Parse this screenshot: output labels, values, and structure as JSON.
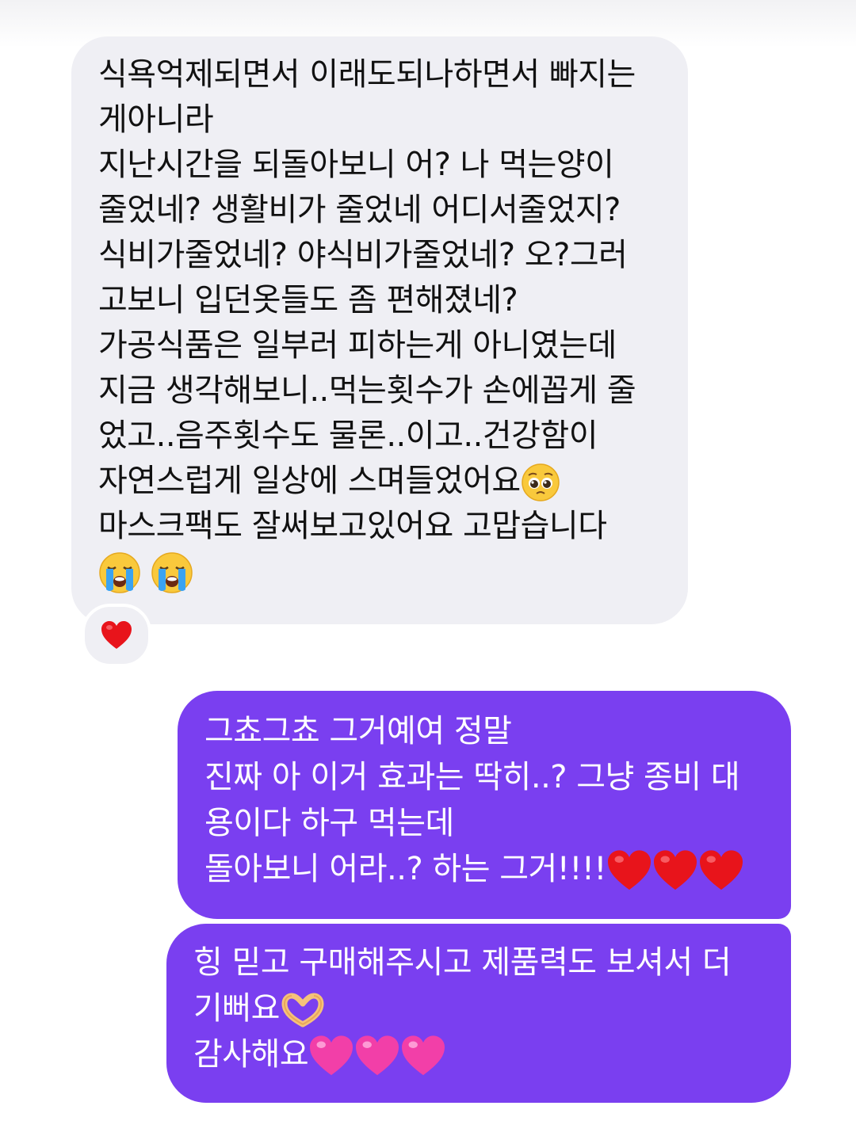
{
  "conversation": {
    "incoming_message": {
      "lines": [
        "식욕억제되면서 이래도되나하면서 빠지는",
        "게아니라",
        "지난시간을 되돌아보니 어? 나 먹는양이",
        "줄었네? 생활비가 줄었네 어디서줄었지?",
        "식비가줄었네? 야식비가줄었네? 오?그러",
        "고보니 입던옷들도 좀 편해졌네?",
        "가공식품은 일부러 피하는게 아니였는데",
        "지금 생각해보니..먹는횟수가 손에꼽게 줄",
        "었고..음주횟수도 물론..이고..건강함이",
        "자연스럽게 일상에 스며들었어요",
        "마스크팩도 잘써보고있어요 고맙습니다"
      ],
      "emojis": [
        "pleading-face",
        "loudly-crying-face",
        "loudly-crying-face"
      ],
      "reaction": "red-heart"
    },
    "outgoing_message_1": {
      "lines": [
        "그쵸그쵸 그거예여 정말",
        "진짜 아 이거 효과는 딱히..? 그냥 종비 대",
        "용이다 하구 먹는데",
        "돌아보니 어라..? 하는 그거!!!!"
      ],
      "emojis": [
        "red-heart",
        "red-heart",
        "red-heart"
      ]
    },
    "outgoing_message_2": {
      "lines": [
        "힝 믿고 구매해주시고 제품력도 보셔서 더",
        "기뻐요",
        "감사해요"
      ],
      "emojis": [
        "heart-hands",
        "pink-heart",
        "pink-heart",
        "pink-heart"
      ]
    }
  },
  "colors": {
    "incoming_bubble": "#efeff4",
    "outgoing_bubble": "#7a3ff0",
    "incoming_text": "#111111",
    "outgoing_text": "#ffffff",
    "red_heart": "#e8141b",
    "pink_heart": "#f23fa8"
  }
}
